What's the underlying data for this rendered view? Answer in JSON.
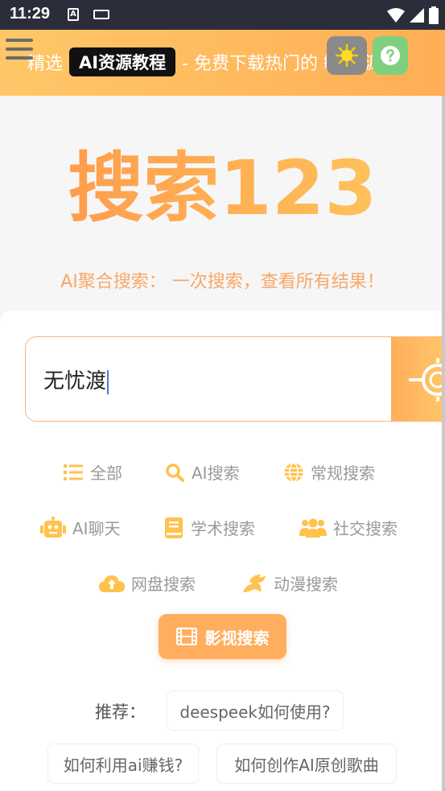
{
  "status_bar": {
    "time": "11:29",
    "a_icon": "A"
  },
  "banner": {
    "prefix": "精选",
    "tag": "AI资源教程",
    "suffix": "- 免费下载热门的 敏 资源！"
  },
  "logo": {
    "text": "搜索123"
  },
  "subtitle": "AI聚合搜索： 一次搜索，查看所有结果！",
  "search": {
    "value": "无忧渡"
  },
  "categories": [
    {
      "label": "全部",
      "icon": "list-icon"
    },
    {
      "label": "AI搜索",
      "icon": "search-icon"
    },
    {
      "label": "常规搜索",
      "icon": "globe-icon"
    },
    {
      "label": "AI聊天",
      "icon": "robot-icon"
    },
    {
      "label": "学术搜索",
      "icon": "book-icon"
    },
    {
      "label": "社交搜索",
      "icon": "users-icon"
    },
    {
      "label": "网盘搜索",
      "icon": "cloud-upload-icon"
    },
    {
      "label": "动漫搜索",
      "icon": "dragon-icon"
    }
  ],
  "active_category": {
    "label": "影视搜索",
    "icon": "film-icon"
  },
  "recommend": {
    "label": "推荐：",
    "items": [
      "deespeek如何使用?",
      "如何利用ai赚钱?",
      "如何创作AI原创歌曲"
    ]
  },
  "colors": {
    "accent": "#ffae5e",
    "icon": "#ffc24d",
    "banner_start": "#ffc768",
    "banner_end": "#ffae55"
  }
}
